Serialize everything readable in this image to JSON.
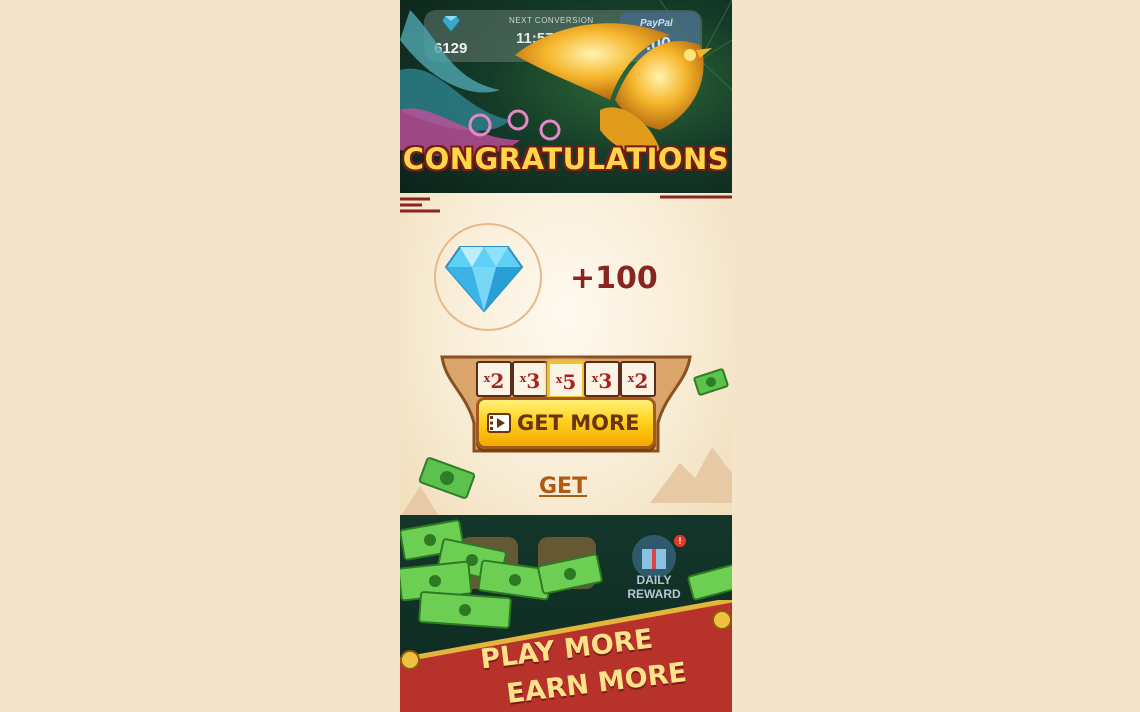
{
  "hud": {
    "gem_count": "6129",
    "next_conversion_label": "NEXT CONVERSION",
    "next_conversion_timer": "11:57:51",
    "paypal_label": "PayPal",
    "paypal_amount": "0.00"
  },
  "dialog": {
    "title": "CONGRATULATIONS",
    "reward_icon": "diamond-icon",
    "reward_amount": "+100",
    "multipliers": [
      {
        "prefix": "x",
        "value": "2"
      },
      {
        "prefix": "x",
        "value": "3"
      },
      {
        "prefix": "x",
        "value": "5"
      },
      {
        "prefix": "x",
        "value": "3"
      },
      {
        "prefix": "x",
        "value": "2"
      }
    ],
    "active_multiplier_index": 2,
    "get_more_button": "GET MORE",
    "get_more_icon": "video-ad-icon",
    "get_link": "GET"
  },
  "bottom": {
    "daily_reward_label": "DAILY REWARD",
    "daily_reward_badge": "!"
  },
  "banner": {
    "line1": "PLAY MORE",
    "line2": "EARN MORE"
  },
  "colors": {
    "background": "#f4e4c9",
    "title_gold": "#ffd84a",
    "button_yellow": "#ffd21f",
    "reward_text": "#8a2420",
    "banner_red": "#b7322a"
  }
}
